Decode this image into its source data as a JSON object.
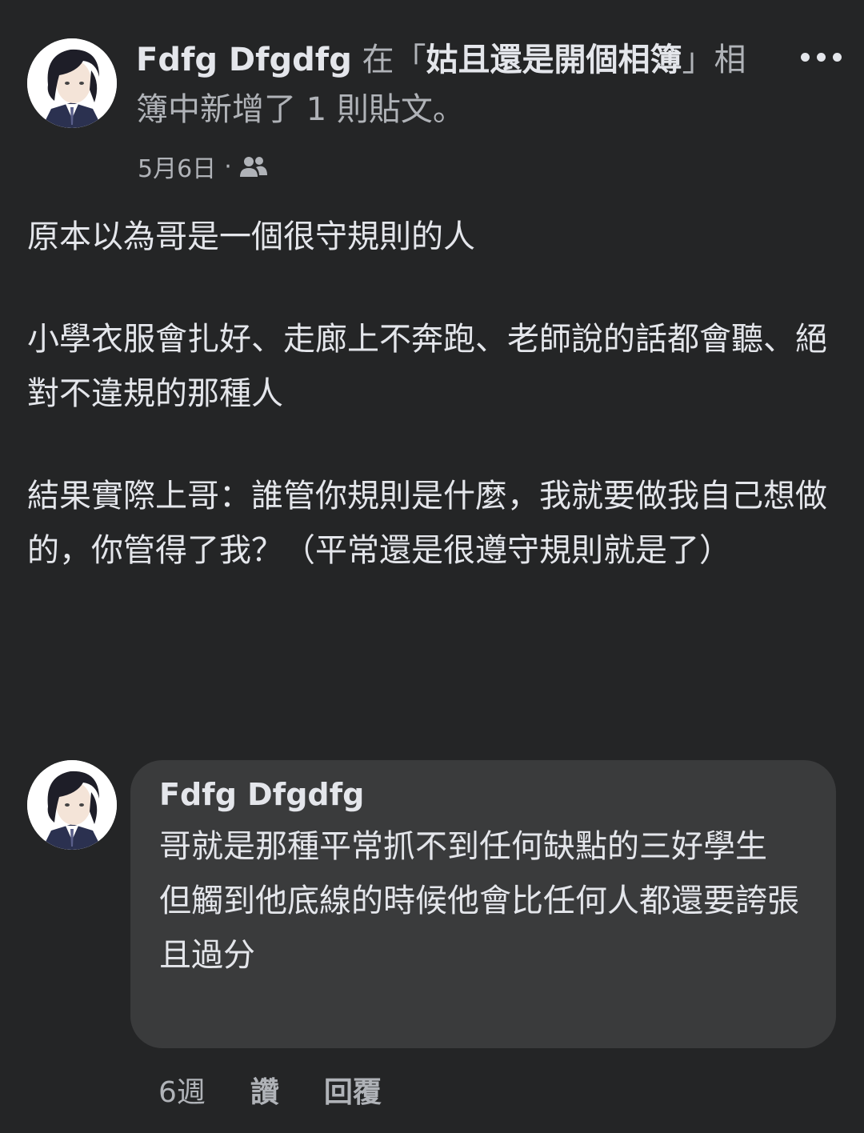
{
  "post": {
    "author": "Fdfg Dfgdfg",
    "header_prefix": " 在「",
    "album_name": "姑且還是開個相簿",
    "header_suffix": "」相簿中新增了 1 則貼文。",
    "date": "5月6日",
    "meta_separator": "·",
    "audience_icon": "friends-icon",
    "paragraphs": [
      "原本以為哥是一個很守規則的人",
      "小學衣服會扎好、走廊上不奔跑、老師說的話都會聽、絕對不違規的那種人",
      "結果實際上哥：誰管你規則是什麼，我就要做我自己想做的，你管得了我？（平常還是很遵守規則就是了）"
    ]
  },
  "comment": {
    "author": "Fdfg Dfgdfg",
    "text": "哥就是那種平常抓不到任何缺點的三好學生\n但觸到他底線的時候他會比任何人都還要誇張且過分",
    "time": "6週",
    "like_label": "讚",
    "reply_label": "回覆"
  },
  "colors": {
    "background": "#242526",
    "bubble": "#3a3b3c",
    "primary_text": "#e4e6eb",
    "secondary_text": "#b0b3b8"
  }
}
